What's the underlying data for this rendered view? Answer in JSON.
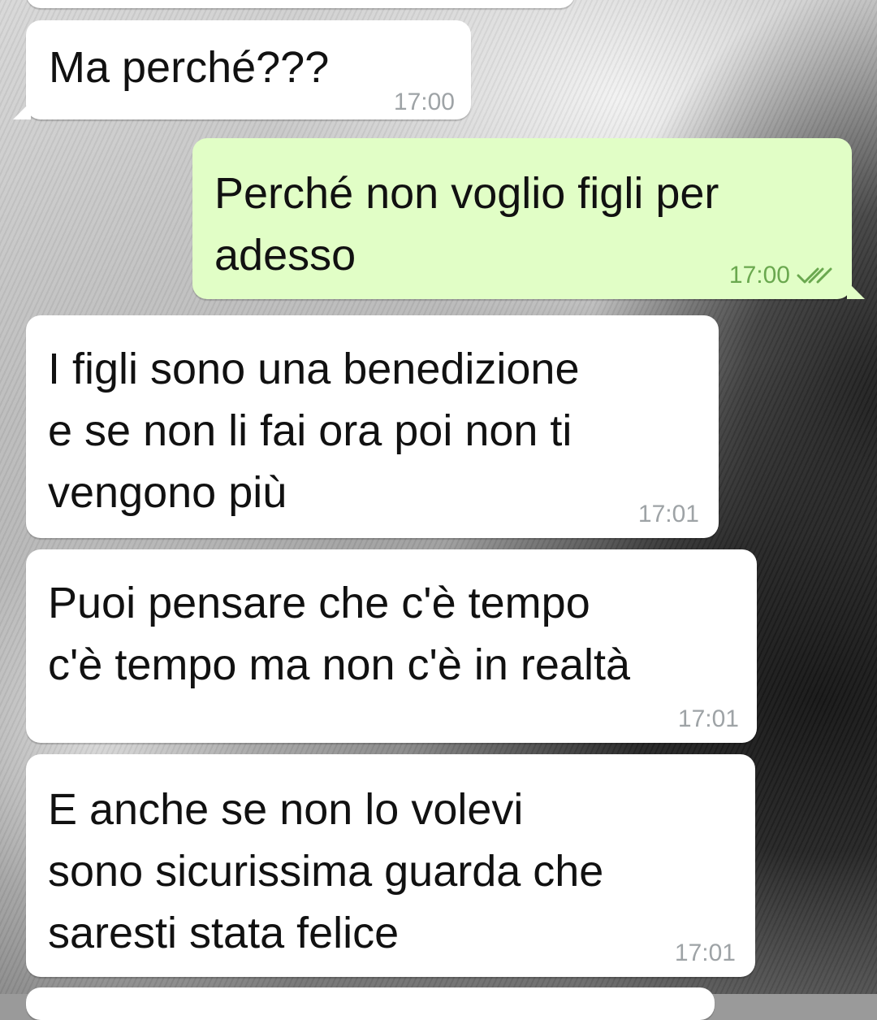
{
  "chat": {
    "messages": [
      {
        "id": "m1",
        "direction": "incoming",
        "text": "Ma perché???",
        "time": "17:00"
      },
      {
        "id": "m2",
        "direction": "outgoing",
        "text": "Perché non voglio figli per\nadesso",
        "time": "17:00",
        "status_icon": "double-check-icon"
      },
      {
        "id": "m3",
        "direction": "incoming",
        "text": "I figli sono una benedizione\ne se non li fai ora poi non ti\nvengono più",
        "time": "17:01"
      },
      {
        "id": "m4",
        "direction": "incoming",
        "text": "Puoi pensare che c'è tempo\nc'è tempo ma non c'è in realtà",
        "time": "17:01"
      },
      {
        "id": "m5",
        "direction": "incoming",
        "text": "E anche se non lo volevi\nsono sicurissima guarda che\nsaresti stata felice",
        "time": "17:01"
      }
    ]
  },
  "colors": {
    "incoming_bubble": "#ffffff",
    "outgoing_bubble": "#e1fec6",
    "outgoing_time": "#6aa84f",
    "incoming_time": "#9ea3a6",
    "read_check": "#6aa84f"
  }
}
